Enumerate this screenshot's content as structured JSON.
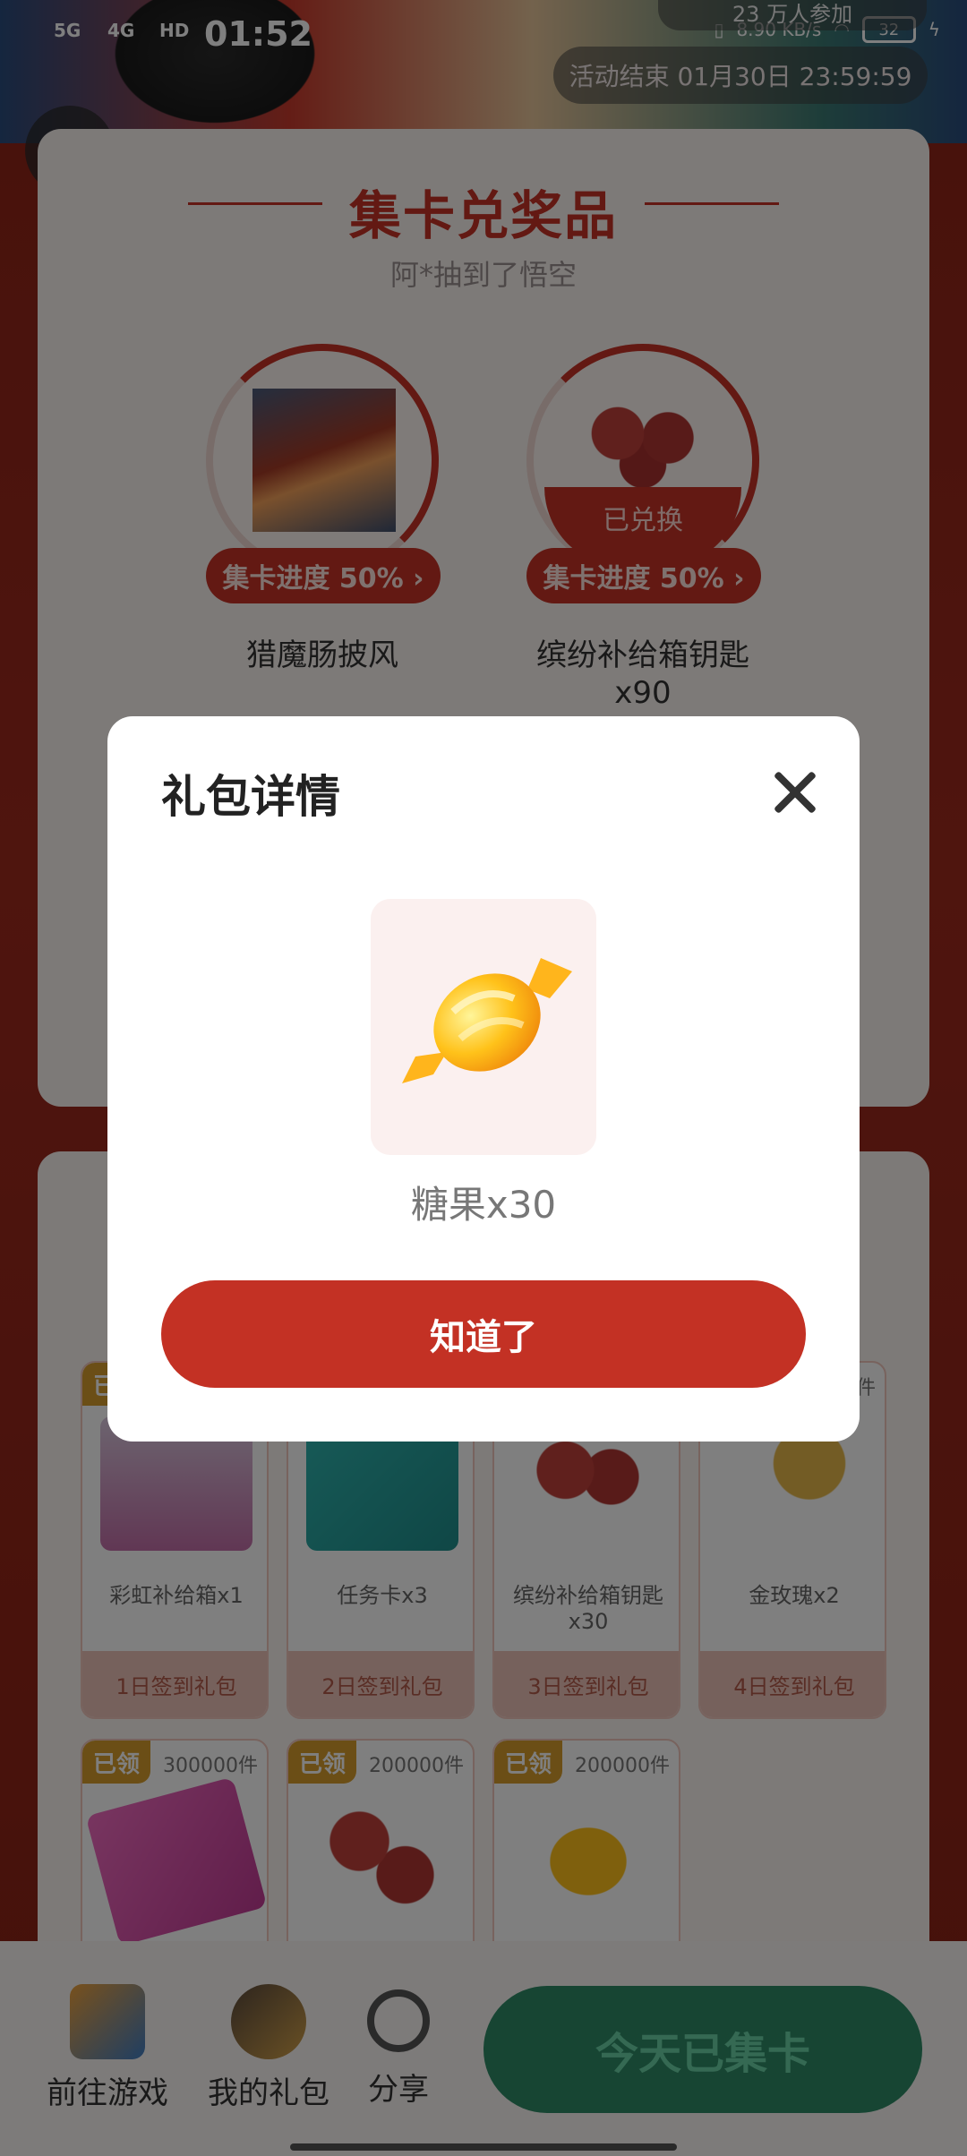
{
  "status": {
    "time": "01:52",
    "net1": "5G",
    "net2": "4G",
    "hd": "HD",
    "speed": "8.90 KB/s",
    "battery": "32"
  },
  "header": {
    "participants": "23 万人参加",
    "deadline": "活动结束 01月30日 23:59:59"
  },
  "collect_section": {
    "title": "集卡兑奖品",
    "subtitle": "阿*抽到了悟空",
    "prizes": [
      {
        "name": "猎魔肠披风",
        "progress": "集卡进度 50% ›",
        "exchanged": ""
      },
      {
        "name": "缤纷补给箱钥匙",
        "name_line2": "x90",
        "progress": "集卡进度 50% ›",
        "exchanged": "已兑换"
      }
    ]
  },
  "gifts": [
    {
      "tag": "已",
      "count": "",
      "name": "彩虹补给箱x1",
      "footer": "1日签到礼包"
    },
    {
      "tag": "",
      "count": "",
      "name": "任务卡x3",
      "footer": "2日签到礼包"
    },
    {
      "tag": "",
      "count": "",
      "name": "缤纷补给箱钥匙 x30",
      "footer": "3日签到礼包"
    },
    {
      "tag": "",
      "count": "件",
      "name": "金玫瑰x2",
      "footer": "4日签到礼包"
    },
    {
      "tag": "已领",
      "count": "300000件",
      "name": "",
      "footer": ""
    },
    {
      "tag": "已领",
      "count": "200000件",
      "name": "",
      "footer": ""
    },
    {
      "tag": "已领",
      "count": "200000件",
      "name": "",
      "footer": ""
    }
  ],
  "bottom_bar": {
    "go_game": "前往游戏",
    "my_gifts": "我的礼包",
    "share": "分享",
    "collect_button": "今天已集卡"
  },
  "modal": {
    "title": "礼包详情",
    "item_name": "糖果x30",
    "confirm_label": "知道了"
  },
  "colors": {
    "accent": "#c63326",
    "button_red": "#c33124",
    "green": "#2f8a66"
  }
}
